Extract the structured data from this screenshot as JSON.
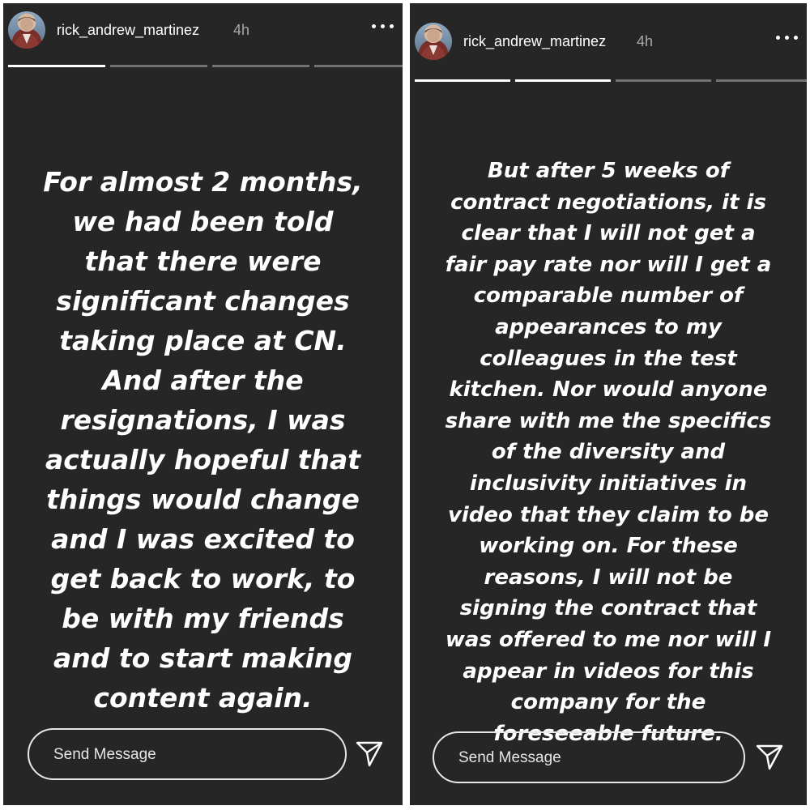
{
  "stories": [
    {
      "username": "rick_andrew_martinez",
      "time": "4h",
      "progress": [
        1,
        0,
        0,
        0
      ],
      "text": "For almost 2 months,\nwe had been told\nthat there were\nsignificant changes\ntaking place at CN.\nAnd after the\nresignations, I was\nactually hopeful that\nthings would change\nand I was excited to\nget back to work, to\nbe with my friends\nand to start making\ncontent again.",
      "reply_placeholder": "Send Message",
      "icons": {
        "more": "more-horizontal-icon",
        "send": "paper-plane-icon",
        "avatar": "profile-photo"
      }
    },
    {
      "username": "rick_andrew_martinez",
      "time": "4h",
      "progress": [
        1,
        1,
        0,
        0
      ],
      "text": "But after 5 weeks of\ncontract negotiations, it is\nclear that I will not get a\nfair pay rate nor will I get a\ncomparable number of\nappearances to my\ncolleagues in the test\nkitchen. Nor would anyone\nshare with me the specifics\nof the diversity and\ninclusivity initiatives in\nvideo that they claim to be\nworking on. For these\nreasons, I will not be\nsigning the contract that\nwas offered to me nor will I\nappear in videos for this\ncompany for the\nforeseeable future.",
      "reply_placeholder": "Send Message",
      "icons": {
        "more": "more-horizontal-icon",
        "send": "paper-plane-icon",
        "avatar": "profile-photo"
      }
    }
  ],
  "colors": {
    "background": "#262626",
    "text": "#ffffff",
    "muted": "#a8a8a8",
    "progress_track": "rgba(255,255,255,0.35)"
  }
}
